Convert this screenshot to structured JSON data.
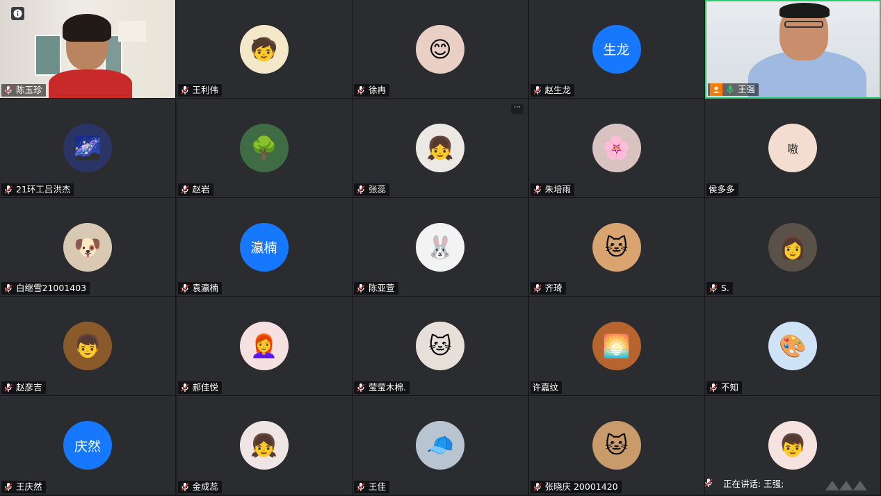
{
  "participants": [
    {
      "name": "陈玉珍",
      "kind": "video1"
    },
    {
      "name": "王利伟",
      "kind": "emoji",
      "emoji": "🧒",
      "bg": "#f3e9c9"
    },
    {
      "name": "徐冉",
      "kind": "emoji",
      "emoji": "😊",
      "bg": "#e9cfc4"
    },
    {
      "name": "赵生龙",
      "kind": "text",
      "initials": "生龙"
    },
    {
      "name": "王强",
      "kind": "video2"
    },
    {
      "name": "21环工吕洪杰",
      "kind": "emoji",
      "emoji": "🌌",
      "bg": "#2a3566"
    },
    {
      "name": "赵岩",
      "kind": "emoji",
      "emoji": "🌳",
      "bg": "#3f6b45"
    },
    {
      "name": "张蕊",
      "kind": "emoji",
      "emoji": "👧",
      "bg": "#ece8e3"
    },
    {
      "name": "朱培雨",
      "kind": "emoji",
      "emoji": "🌸",
      "bg": "#d9c3c0"
    },
    {
      "name": "侯多多",
      "kind": "emoji",
      "emoji": "嗷",
      "bg": "#f2ddd0"
    },
    {
      "name": "白继雪21001403",
      "kind": "emoji",
      "emoji": "🐶",
      "bg": "#d9c9b3"
    },
    {
      "name": "袁瀛楠",
      "kind": "text",
      "initials": "瀛楠"
    },
    {
      "name": "陈亚萱",
      "kind": "emoji",
      "emoji": "🐰",
      "bg": "#f3f3f3"
    },
    {
      "name": "齐琦",
      "kind": "emoji",
      "emoji": "🐱",
      "bg": "#d9a470"
    },
    {
      "name": "S.",
      "kind": "emoji",
      "emoji": "👩",
      "bg": "#5a5148"
    },
    {
      "name": "赵彦吉",
      "kind": "emoji",
      "emoji": "👦",
      "bg": "#8a5a2a"
    },
    {
      "name": "郝佳悦",
      "kind": "emoji",
      "emoji": "👩‍🦰",
      "bg": "#f6e0e0"
    },
    {
      "name": "莹莹木棉.",
      "kind": "emoji",
      "emoji": "🐱",
      "bg": "#e7e0d8"
    },
    {
      "name": "许嘉纹",
      "kind": "emoji",
      "emoji": "🌅",
      "bg": "#b5652d"
    },
    {
      "name": "不知",
      "kind": "emoji",
      "emoji": "🎨",
      "bg": "#cfe3f6"
    },
    {
      "name": "王庆然",
      "kind": "text",
      "initials": "庆然"
    },
    {
      "name": "金成蕊",
      "kind": "emoji",
      "emoji": "👧",
      "bg": "#f0e5e5"
    },
    {
      "name": "王佳",
      "kind": "emoji",
      "emoji": "🧢",
      "bg": "#b8c4cf"
    },
    {
      "name": "张晓庆  20001420",
      "kind": "emoji",
      "emoji": "🐱",
      "bg": "#c99a6a"
    },
    {
      "name": "",
      "kind": "emoji",
      "emoji": "👦",
      "bg": "#f6e3e0"
    }
  ],
  "speaker": {
    "label": "正在讲话: 王强;"
  },
  "colors": {
    "accent": "#1677ff",
    "active_border": "#2ecc71",
    "orange": "#ff7a00"
  }
}
